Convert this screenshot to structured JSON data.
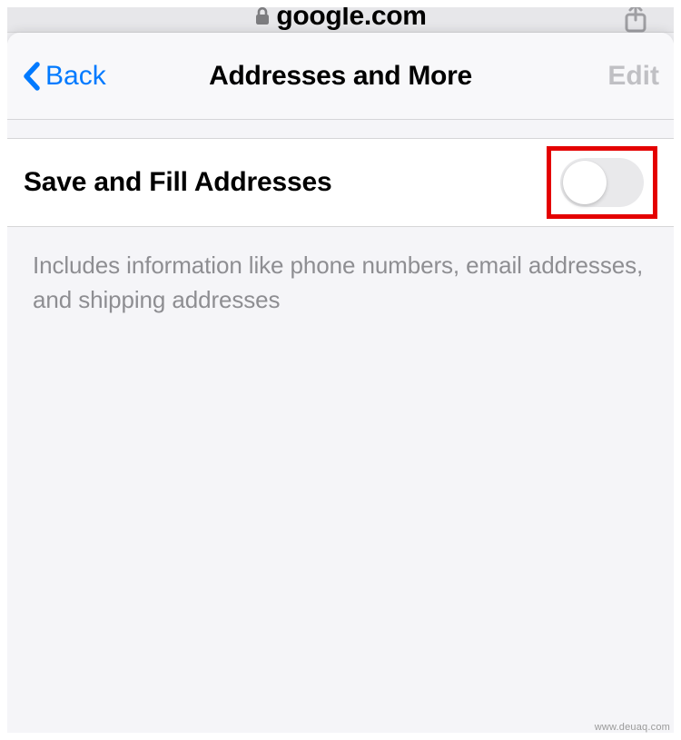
{
  "url_bar": {
    "domain": "google.com"
  },
  "nav": {
    "back_label": "Back",
    "title": "Addresses and More",
    "edit_label": "Edit"
  },
  "settings": {
    "save_fill": {
      "label": "Save and Fill Addresses",
      "enabled": false
    },
    "description": "Includes information like phone numbers, email addresses, and shipping addresses"
  },
  "watermark": "www.deuaq.com"
}
